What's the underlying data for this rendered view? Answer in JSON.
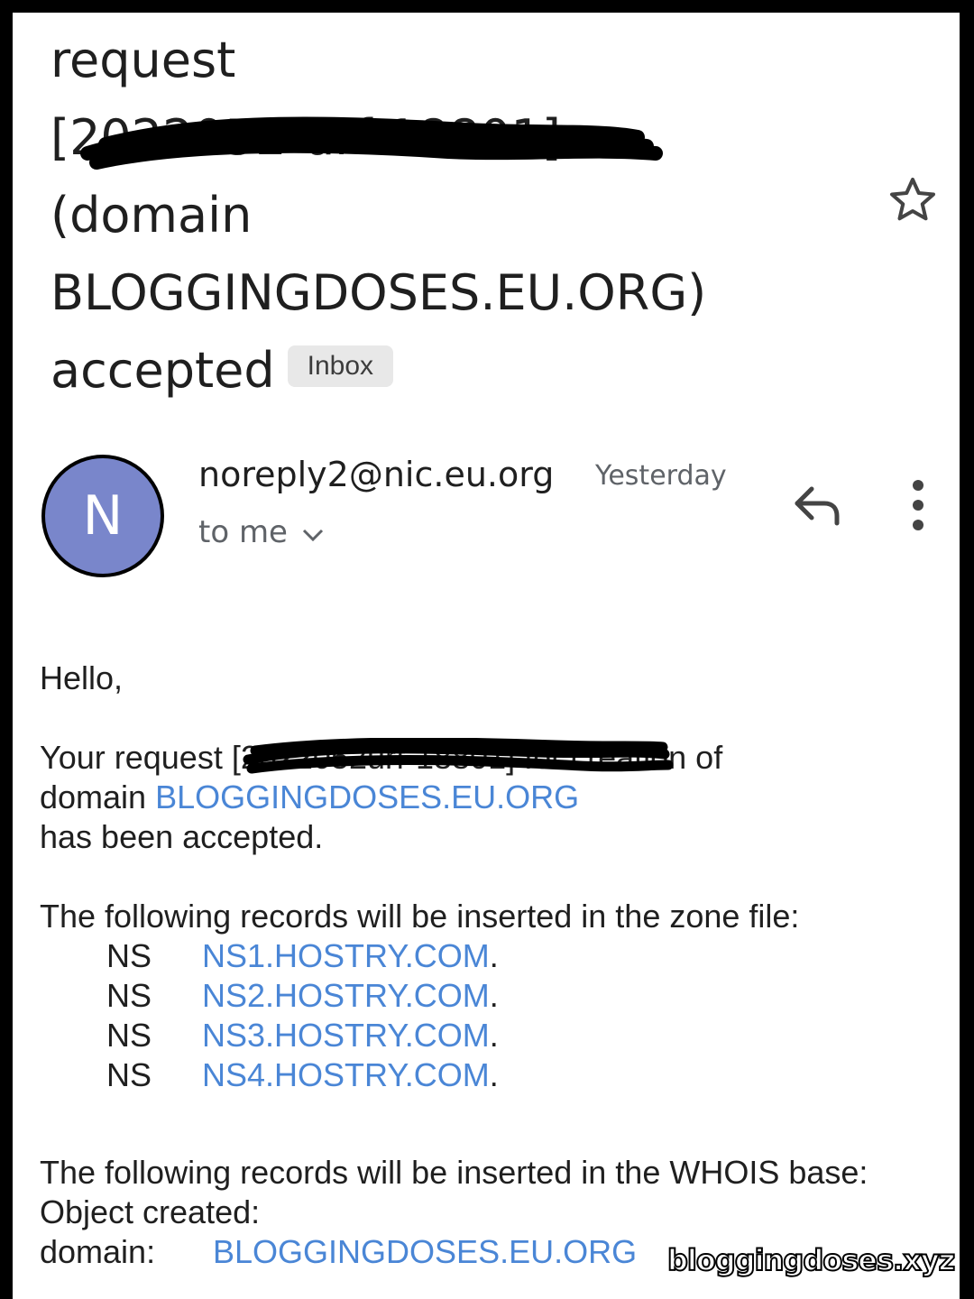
{
  "email": {
    "subject": {
      "line1": "request",
      "line2_open": "[",
      "line2_redacted": "2022052",
      "line2_visible_tail": "-urf-18801]",
      "line3": "(domain",
      "line4": "BLOGGINGDOSES.EU.ORG)",
      "line5": "accepted",
      "label_chip": "Inbox"
    },
    "star_icon": "star-outline-icon",
    "sender": {
      "avatar_letter": "N",
      "avatar_color": "#7986cb",
      "address": "noreply2@nic.eu.org",
      "date": "Yesterday",
      "recipient": "to me"
    },
    "actions": {
      "reply_icon": "reply-icon",
      "more_icon": "more-vert-icon"
    },
    "body": {
      "greeting": "Hello,",
      "request_prefix": "Your request [",
      "request_redacted": "2022052",
      "request_tail": "urf-18801]",
      "request_suffix": " for creation of",
      "domain_prefix": "domain ",
      "domain_link": "BLOGGINGDOSES.EU.ORG",
      "accepted_line": "has been accepted.",
      "zone_intro": "The following records will be inserted in the zone file:",
      "ns_records": [
        {
          "type": "NS",
          "host": "NS1.HOSTRY.COM",
          "dot": "."
        },
        {
          "type": "NS",
          "host": "NS2.HOSTRY.COM",
          "dot": "."
        },
        {
          "type": "NS",
          "host": "NS3.HOSTRY.COM",
          "dot": "."
        },
        {
          "type": "NS",
          "host": "NS4.HOSTRY.COM",
          "dot": "."
        }
      ],
      "whois_intro": "The following records will be inserted in the WHOIS base:",
      "object_created": "Object created:",
      "whois_domain_key": "domain:",
      "whois_domain_value": "BLOGGINGDOSES.EU.ORG"
    },
    "link_color": "#4a86d6"
  },
  "watermark": "bloggingdoses.xyz"
}
